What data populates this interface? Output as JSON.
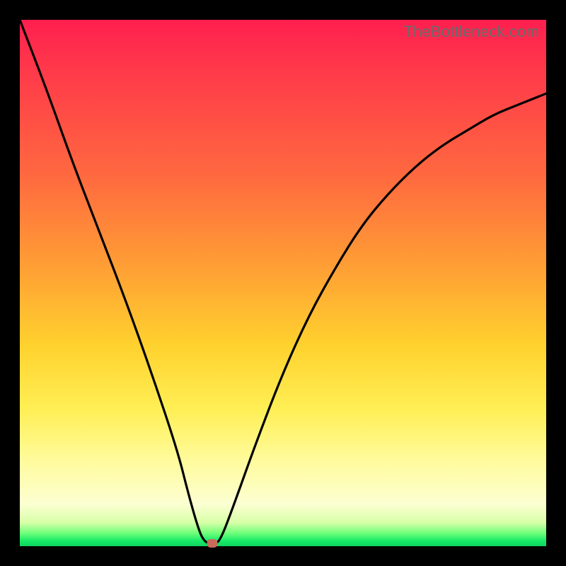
{
  "watermark": "TheBottleneck.com",
  "colors": {
    "frame_bg": "#000000",
    "watermark_text": "#6b6b6b",
    "curve_stroke": "#000000",
    "marker_fill": "#c96a5a",
    "gradient_stops": [
      "#ff1f4f",
      "#ff3a4a",
      "#ff6a3f",
      "#ffa234",
      "#ffd22e",
      "#ffef55",
      "#fffb9e",
      "#fcffd2",
      "#d8ffa8",
      "#6fff7a",
      "#18e968",
      "#0fd65f"
    ]
  },
  "chart_data": {
    "type": "line",
    "title": "",
    "xlabel": "",
    "ylabel": "",
    "xlim": [
      0,
      100
    ],
    "ylim": [
      0,
      100
    ],
    "annotations": [
      "TheBottleneck.com"
    ],
    "series": [
      {
        "name": "bottleneck-curve",
        "x": [
          0,
          5,
          10,
          15,
          20,
          25,
          30,
          32,
          34,
          35,
          36,
          37,
          38,
          40,
          45,
          50,
          55,
          60,
          65,
          70,
          75,
          80,
          85,
          90,
          95,
          100
        ],
        "values": [
          100,
          87,
          73,
          60,
          47,
          33,
          18,
          10,
          3,
          1,
          0.5,
          0.5,
          1,
          6,
          20,
          33,
          44,
          53,
          61,
          67,
          72,
          76,
          79,
          82,
          84,
          86
        ]
      }
    ],
    "marker": {
      "x": 36.5,
      "y": 0.5,
      "color": "#c96a5a"
    }
  }
}
